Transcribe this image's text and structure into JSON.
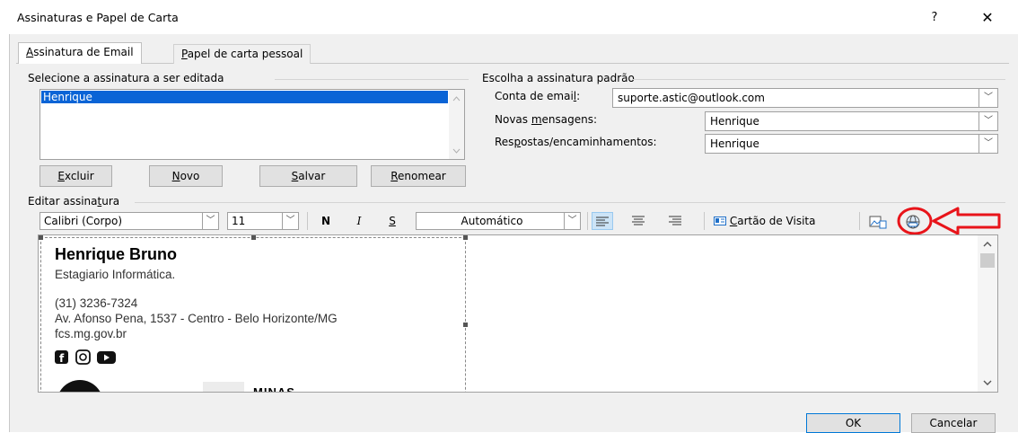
{
  "window": {
    "title": "Assinaturas e Papel de Carta",
    "help_label": "?",
    "close_label": "✕"
  },
  "tabs": [
    {
      "label": "Assinatura de Email",
      "active": true
    },
    {
      "label": "Papel de carta pessoal",
      "active": false
    }
  ],
  "select_section": {
    "label": "Selecione a assinatura a ser editada",
    "items": [
      "Henrique"
    ],
    "selected": "Henrique",
    "buttons": {
      "delete": "Excluir",
      "new": "Novo",
      "save": "Salvar",
      "rename": "Renomear"
    }
  },
  "default_section": {
    "label": "Escolha a assinatura padrão",
    "account_label": "Conta de email:",
    "account_value": "suporte.astic@outlook.com",
    "new_messages_label": "Novas mensagens:",
    "new_messages_value": "Henrique",
    "replies_label": "Respostas/encaminhamentos:",
    "replies_value": "Henrique"
  },
  "editor": {
    "label": "Editar assinatura",
    "font": "Calibri (Corpo)",
    "size": "11",
    "bold": "N",
    "italic": "I",
    "underline": "S",
    "color": "Automático",
    "business_card": "Cartão de Visita",
    "signature": {
      "name": "Henrique Bruno",
      "role": "Estagiario Informática.",
      "phone": "(31) 3236-7324",
      "address": "Av. Afonso Pena, 1537 - Centro - Belo Horizonte/MG",
      "website": "fcs.mg.gov.br",
      "footer_text": "MINAS"
    }
  },
  "footer": {
    "ok": "OK",
    "cancel": "Cancelar"
  },
  "colors": {
    "selection": "#0a64d6",
    "annotation": "#e8141a",
    "dialog_bg": "#f0f0f0"
  }
}
